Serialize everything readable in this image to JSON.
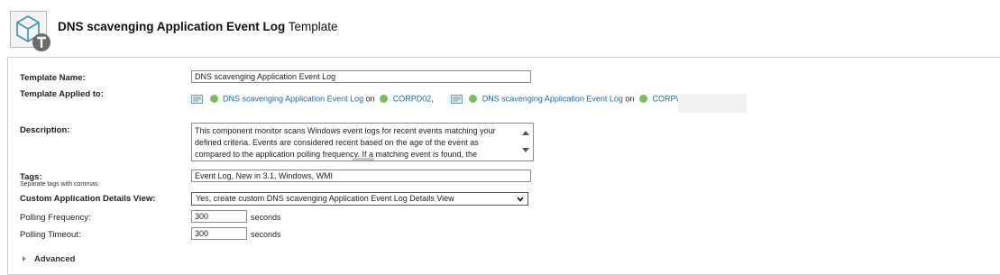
{
  "header": {
    "title_bold": "DNS scavenging Application Event Log",
    "title_suffix": " Template",
    "icon": "template-icon"
  },
  "form": {
    "template_name_label": "Template Name:",
    "template_name_value": "DNS scavenging Application Event Log",
    "applied_label": "Template Applied to:",
    "applied": [
      {
        "app": "DNS scavenging Application Event Log",
        "on": "on",
        "node": "CORPD02",
        "sep": ","
      },
      {
        "app": "DNS scavenging Application Event Log",
        "on": "on",
        "node": "CORPW2D01",
        "sep": ""
      }
    ],
    "description_label": "Description:",
    "description_value": "This component monitor scans Windows event logs for recent events matching your defined criteria. Events are considered recent based on the age of the event as compared to the application polling frequency. If a matching event is found, the",
    "tags_label": "Tags:",
    "tags_hint": "Separate tags with commas.",
    "tags_value": "Event Log, New in 3.1, Windows, WMI",
    "details_view_label": "Custom Application Details View:",
    "details_view_value": "Yes, create custom DNS scavenging Application Event Log Details View",
    "polling_frequency_label": "Polling Frequency:",
    "polling_frequency_value": "300",
    "polling_timeout_label": "Polling Timeout:",
    "polling_timeout_value": "300",
    "seconds_label": "seconds",
    "advanced_label": "Advanced"
  },
  "colors": {
    "link": "#1a6aa0",
    "status_up": "#77c057"
  }
}
